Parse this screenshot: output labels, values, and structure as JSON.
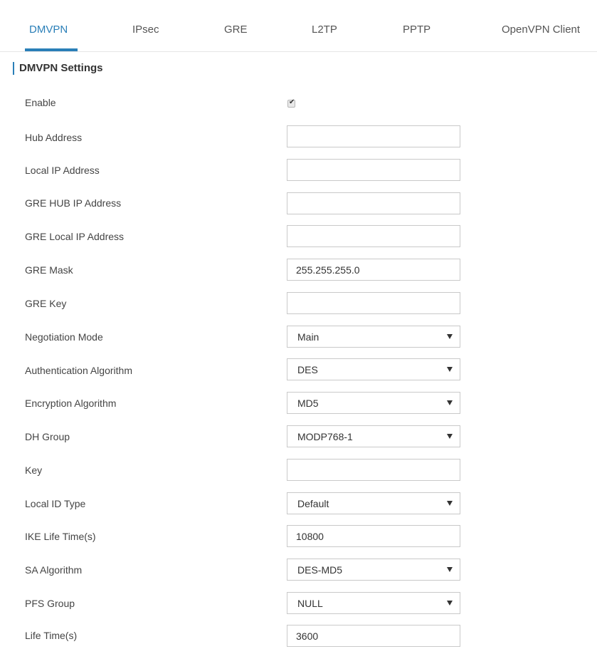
{
  "tabs": [
    {
      "label": "DMVPN",
      "active": true
    },
    {
      "label": "IPsec",
      "active": false
    },
    {
      "label": "GRE",
      "active": false
    },
    {
      "label": "L2TP",
      "active": false
    },
    {
      "label": "PPTP",
      "active": false
    },
    {
      "label": "OpenVPN Client",
      "active": false
    }
  ],
  "section_title": "DMVPN Settings",
  "accent_color": "#2a7fb8",
  "form": {
    "enable": {
      "label": "Enable",
      "checked": true
    },
    "hub_address": {
      "label": "Hub Address",
      "value": ""
    },
    "local_ip_address": {
      "label": "Local IP Address",
      "value": ""
    },
    "gre_hub_ip_address": {
      "label": "GRE HUB IP Address",
      "value": ""
    },
    "gre_local_ip_address": {
      "label": "GRE Local IP Address",
      "value": ""
    },
    "gre_mask": {
      "label": "GRE Mask",
      "value": "255.255.255.0"
    },
    "gre_key": {
      "label": "GRE Key",
      "value": ""
    },
    "negotiation_mode": {
      "label": "Negotiation Mode",
      "value": "Main"
    },
    "authentication_algorithm": {
      "label": "Authentication Algorithm",
      "value": "DES"
    },
    "encryption_algorithm": {
      "label": "Encryption Algorithm",
      "value": "MD5"
    },
    "dh_group": {
      "label": "DH Group",
      "value": "MODP768-1"
    },
    "key": {
      "label": "Key",
      "value": ""
    },
    "local_id_type": {
      "label": "Local ID Type",
      "value": "Default"
    },
    "ike_life_time": {
      "label": "IKE Life Time(s)",
      "value": "10800"
    },
    "sa_algorithm": {
      "label": "SA Algorithm",
      "value": "DES-MD5"
    },
    "pfs_group": {
      "label": "PFS Group",
      "value": "NULL"
    },
    "life_time": {
      "label": "Life Time(s)",
      "value": "3600"
    }
  }
}
